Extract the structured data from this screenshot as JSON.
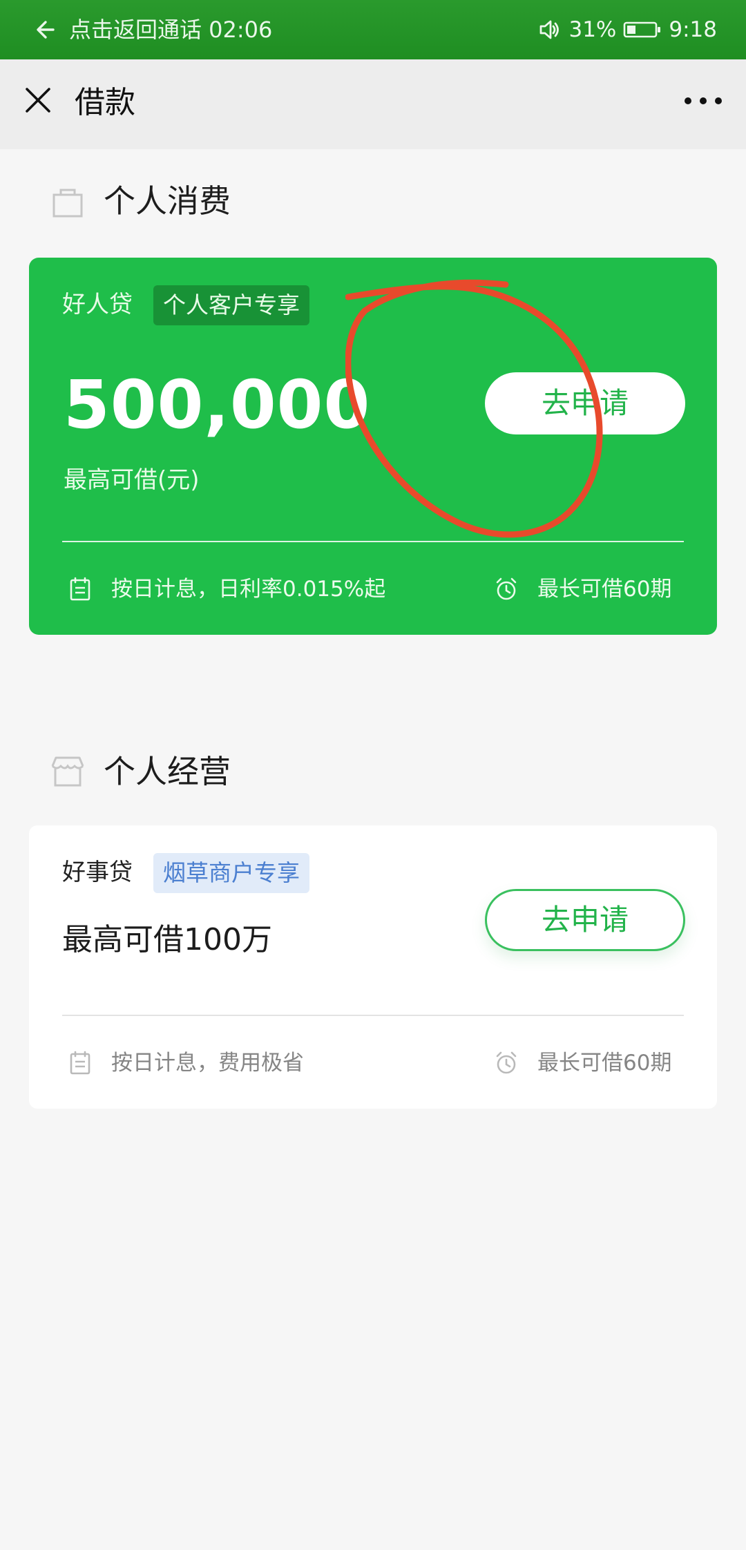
{
  "status_bar": {
    "call_text": "点击返回通话 02:06",
    "battery": "31%",
    "time": "9:18"
  },
  "top_bar": {
    "title": "借款"
  },
  "sections": {
    "consumer": {
      "title": "个人消费",
      "card": {
        "product": "好人贷",
        "tag": "个人客户专享",
        "amount": "500,000",
        "amount_label": "最高可借(元)",
        "apply": "去申请",
        "interest": "按日计息，日利率0.015%起",
        "term": "最长可借60期"
      }
    },
    "business": {
      "title": "个人经营",
      "card": {
        "product": "好事贷",
        "tag": "烟草商户专享",
        "amount_text": "最高可借100万",
        "apply": "去申请",
        "interest": "按日计息，费用极省",
        "term": "最长可借60期"
      }
    }
  },
  "icons": {
    "back": "back-arrow-icon",
    "speaker": "speaker-icon",
    "battery": "battery-icon",
    "close": "close-icon",
    "more": "more-icon",
    "bag": "shopping-bag-icon",
    "store": "store-icon",
    "calendar": "calendar-icon",
    "alarm": "alarm-clock-icon"
  },
  "colors": {
    "status_green": "#1f8e22",
    "card_green": "#1fbe4a",
    "annotation_red": "#e84a2c",
    "tag_blue": "#4b7fd0"
  }
}
